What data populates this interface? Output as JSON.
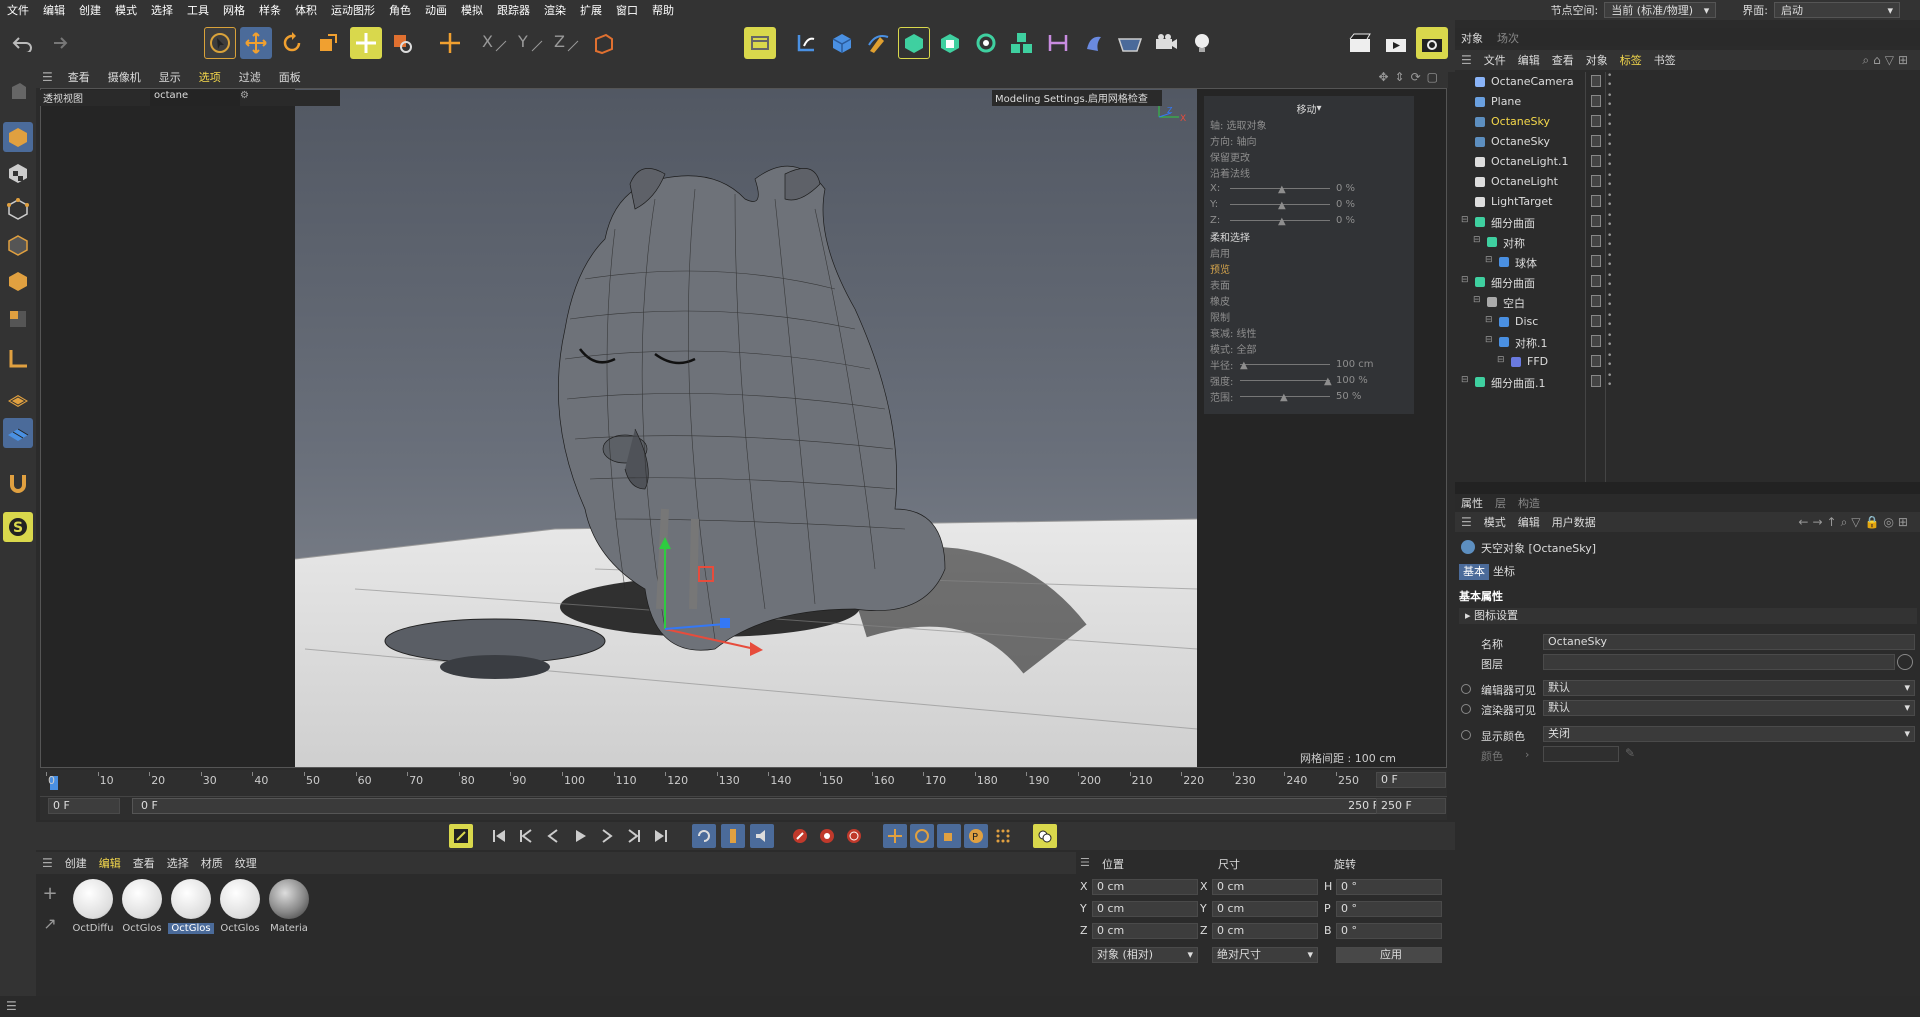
{
  "menubar": {
    "items": [
      "文件",
      "编辑",
      "创建",
      "模式",
      "选择",
      "工具",
      "网格",
      "样条",
      "体积",
      "运动图形",
      "角色",
      "动画",
      "模拟",
      "跟踪器",
      "渲染",
      "扩展",
      "窗口",
      "帮助"
    ],
    "node_space_label": "节点空间:",
    "node_space_value": "当前 (标准/物理)",
    "layout_label": "界面:",
    "layout_value": "启动"
  },
  "viewport": {
    "menu": [
      "查看",
      "摄像机",
      "显示",
      "选项",
      "过滤",
      "面板"
    ],
    "camera_name": "透视视图",
    "renderer": "octane",
    "overlay_text": "Modeling Settings.启用网格检查",
    "grid_spacing": "网格间距 : 100 cm",
    "axis_labels": {
      "x": "X",
      "y": "Y",
      "z": "Z"
    }
  },
  "move_hud": {
    "title": "移动",
    "rows": [
      "轴: 选取对象",
      "方向: 轴向",
      "保留更改",
      "沿着法线"
    ],
    "x": {
      "label": "X:",
      "value": "0 %"
    },
    "y": {
      "label": "Y:",
      "value": "0 %"
    },
    "z": {
      "label": "Z:",
      "value": "0 %"
    },
    "soft_title": "柔和选择",
    "soft_rows": [
      "启用",
      "预览",
      "表面",
      "橡皮",
      "限制"
    ],
    "falloff": "衰减: 线性",
    "mode": "模式: 全部",
    "radius": {
      "label": "半径:",
      "value": "100 cm"
    },
    "strength": {
      "label": "强度:",
      "value": "100 %"
    },
    "range": {
      "label": "范围:",
      "value": "50 %"
    }
  },
  "timeline": {
    "ticks": [
      "0",
      "10",
      "20",
      "30",
      "40",
      "50",
      "60",
      "70",
      "80",
      "90",
      "100",
      "110",
      "120",
      "130",
      "140",
      "150",
      "160",
      "170",
      "180",
      "190",
      "200",
      "210",
      "220",
      "230",
      "240",
      "250"
    ],
    "current_frame": "0 F",
    "start": "0 F",
    "range_start": "0 F",
    "range_end": "250 F",
    "end": "250 F"
  },
  "material_manager": {
    "menu": [
      "创建",
      "编辑",
      "查看",
      "选择",
      "材质",
      "纹理"
    ],
    "materials": [
      {
        "label": "OctDiffu",
        "selected": false
      },
      {
        "label": "OctGlos",
        "selected": false
      },
      {
        "label": "OctGlos",
        "selected": true
      },
      {
        "label": "OctGlos",
        "selected": false
      },
      {
        "label": "Materia",
        "selected": false
      }
    ]
  },
  "coordinates": {
    "headers": [
      "位置",
      "尺寸",
      "旋转"
    ],
    "rows": [
      {
        "pos_label": "X",
        "pos": "0 cm",
        "size_label": "X",
        "size": "0 cm",
        "rot_label": "H",
        "rot": "0 °"
      },
      {
        "pos_label": "Y",
        "pos": "0 cm",
        "size_label": "Y",
        "size": "0 cm",
        "rot_label": "P",
        "rot": "0 °"
      },
      {
        "pos_label": "Z",
        "pos": "0 cm",
        "size_label": "Z",
        "size": "0 cm",
        "rot_label": "B",
        "rot": "0 °"
      }
    ],
    "mode": "对象 (相对)",
    "size_mode": "绝对尺寸",
    "apply": "应用"
  },
  "object_manager": {
    "tabs": [
      "对象",
      "场次"
    ],
    "menu": [
      "文件",
      "编辑",
      "查看",
      "对象",
      "标签",
      "书签"
    ],
    "objects": [
      {
        "name": "OctaneCamera",
        "indent": 0,
        "selected": false
      },
      {
        "name": "Plane",
        "indent": 0,
        "selected": false
      },
      {
        "name": "OctaneSky",
        "indent": 0,
        "selected": true
      },
      {
        "name": "OctaneSky",
        "indent": 0,
        "selected": false
      },
      {
        "name": "OctaneLight.1",
        "indent": 0,
        "selected": false
      },
      {
        "name": "OctaneLight",
        "indent": 0,
        "selected": false
      },
      {
        "name": "LightTarget",
        "indent": 0,
        "selected": false
      },
      {
        "name": "细分曲面",
        "indent": 0,
        "selected": false
      },
      {
        "name": "对称",
        "indent": 1,
        "selected": false
      },
      {
        "name": "球体",
        "indent": 2,
        "selected": false
      },
      {
        "name": "细分曲面",
        "indent": 0,
        "selected": false
      },
      {
        "name": "空白",
        "indent": 1,
        "selected": false
      },
      {
        "name": "Disc",
        "indent": 2,
        "selected": false
      },
      {
        "name": "对称.1",
        "indent": 2,
        "selected": false
      },
      {
        "name": "FFD",
        "indent": 3,
        "selected": false
      },
      {
        "name": "细分曲面.1",
        "indent": 0,
        "selected": false
      }
    ]
  },
  "attributes": {
    "tabs": [
      "属性",
      "层",
      "构造"
    ],
    "menu": [
      "模式",
      "编辑",
      "用户数据"
    ],
    "object_title": "天空对象 [OctaneSky]",
    "subtabs": [
      "基本",
      "坐标"
    ],
    "section": "基本属性",
    "icon_settings": "图标设置",
    "name_label": "名称",
    "name_value": "OctaneSky",
    "layer_label": "图层",
    "editor_visible_label": "编辑器可见",
    "editor_visible_value": "默认",
    "render_visible_label": "渲染器可见",
    "render_visible_value": "默认",
    "display_color_label": "显示颜色",
    "display_color_value": "关闭",
    "color_label": "颜色"
  },
  "colors": {
    "accent_yellow": "#f5d94c",
    "selection_blue": "#4b6b9a",
    "panel": "#2b2b2b",
    "toolbar": "#333333"
  }
}
